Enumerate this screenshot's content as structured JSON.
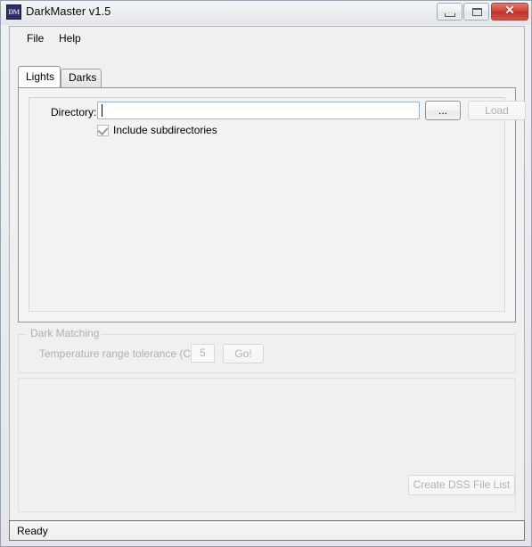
{
  "window": {
    "title": "DarkMaster v1.5",
    "icon_name": "app-icon-dm",
    "icon_text": "DM",
    "controls": {
      "minimize": "minimize-icon",
      "maximize": "maximize-icon",
      "close": "close-icon",
      "close_glyph": "✕"
    },
    "frame_color": "#9aa3ad"
  },
  "menubar": {
    "items": [
      {
        "label": "File"
      },
      {
        "label": "Help"
      }
    ]
  },
  "tabs": {
    "active": "Lights",
    "items": [
      {
        "label": "Lights",
        "selected": true
      },
      {
        "label": "Darks",
        "selected": false
      }
    ]
  },
  "lights_tab": {
    "directory": {
      "label": "Directory:",
      "value": "",
      "placeholder": "",
      "focused": true
    },
    "browse_button": {
      "label": "...",
      "enabled": true
    },
    "load_button": {
      "label": "Load",
      "enabled": false
    },
    "include_subdirectories": {
      "label": "Include subdirectories",
      "checked": true
    }
  },
  "dark_matching": {
    "title": "Dark Matching",
    "enabled": false,
    "tolerance_label": "Temperature range tolerance (C):",
    "tolerance_value": "5",
    "go_button": {
      "label": "Go!",
      "enabled": false
    }
  },
  "footer": {
    "create_dss_button": {
      "label": "Create DSS File List",
      "enabled": false
    }
  },
  "statusbar": {
    "text": "Ready"
  }
}
